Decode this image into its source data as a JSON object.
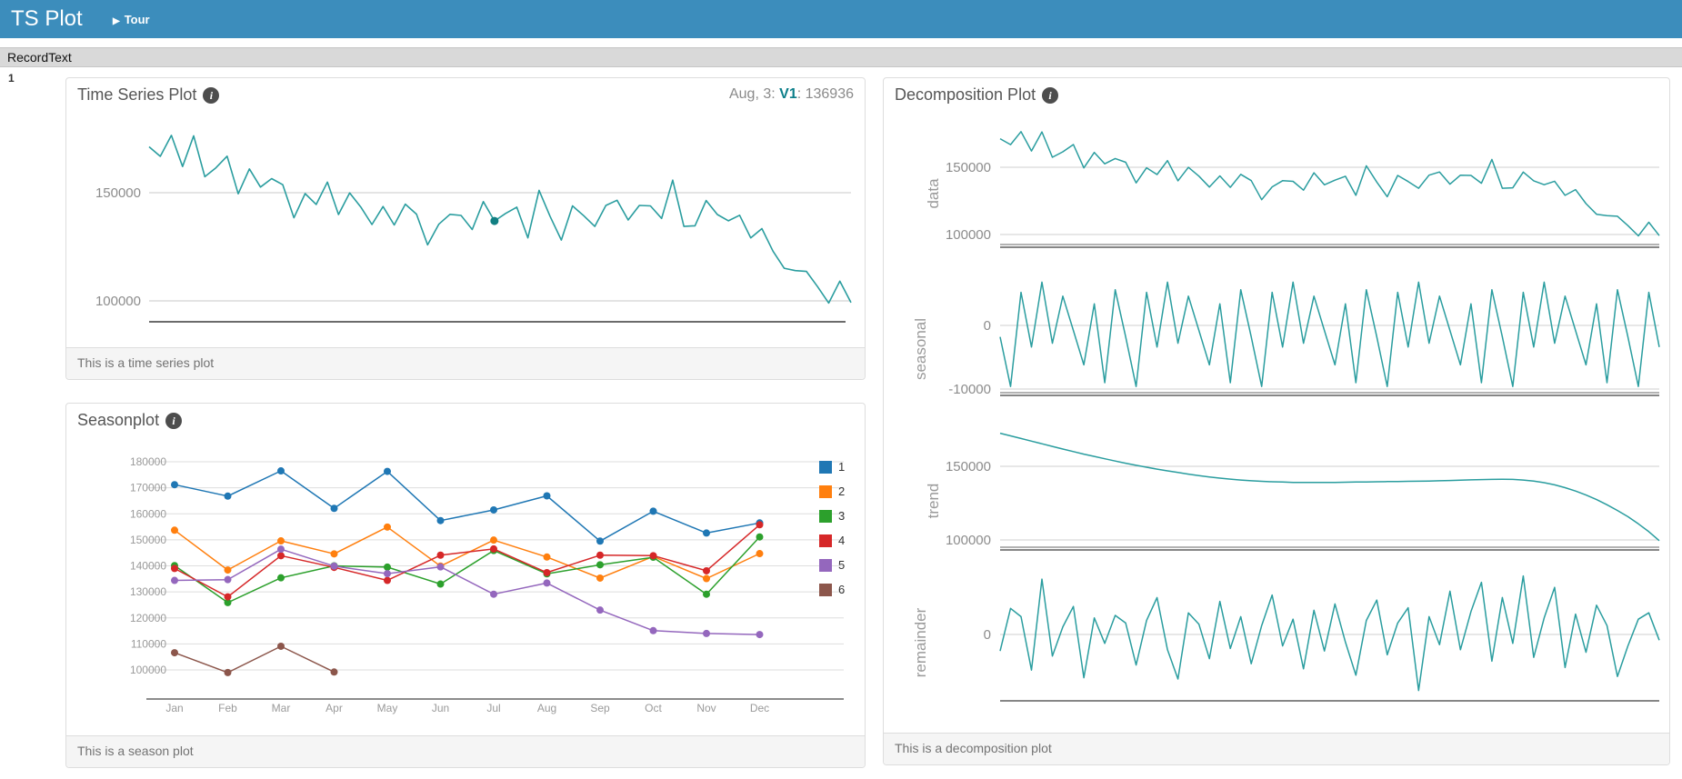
{
  "header": {
    "app_title": "TS Plot",
    "tour_label": "Tour",
    "bg_color": "#3c8dbc"
  },
  "icons": {
    "info": "i",
    "play": "▶"
  },
  "record_bar": {
    "label": "RecordText",
    "row_index": "1"
  },
  "panels": {
    "time_series": {
      "title": "Time Series Plot",
      "hover_prefix": "Aug, 3: ",
      "hover_series": "V1",
      "hover_suffix": ": 136936",
      "footer": "This is a time series plot"
    },
    "seasonplot": {
      "title": "Seasonplot",
      "footer": "This is a season plot"
    },
    "decomposition": {
      "title": "Decomposition Plot",
      "footer": "This is a decomposition plot"
    }
  },
  "colors": {
    "header_bg": "#3c8dbc",
    "line_teal": "#2a9d9f",
    "hover_dot": "#117f82",
    "series_label_teal": "#0c7f8a",
    "grid_light": "#cccccc",
    "axis_dark": "#666666",
    "tick_text": "#8c8c8c"
  },
  "chart_data": [
    {
      "id": "timeseries",
      "type": "line",
      "title": "Time Series Plot",
      "x_unit": "month",
      "x_range": "Year 1 Jan to Year 6 Apr",
      "ylim": [
        75000,
        188000
      ],
      "yticks": [
        150000,
        100000
      ],
      "grid": true,
      "line_color": "#2a9d9f",
      "hover_point": {
        "index": 31,
        "label": "Aug, 3",
        "series": "V1",
        "value": 136936
      },
      "values": [
        171200,
        166800,
        176500,
        162100,
        176300,
        157400,
        161500,
        166900,
        149500,
        161000,
        152600,
        156500,
        153700,
        138400,
        149600,
        144600,
        154900,
        139900,
        149900,
        143400,
        135300,
        143600,
        135100,
        144700,
        140100,
        125900,
        135400,
        140000,
        139500,
        133000,
        145900,
        136936,
        140400,
        143300,
        129100,
        151100,
        139000,
        128100,
        143900,
        139400,
        134400,
        144100,
        146500,
        137400,
        144100,
        143900,
        138100,
        155800,
        134400,
        134700,
        146400,
        139900,
        137000,
        139600,
        129100,
        133400,
        123000,
        115100,
        114000,
        113600,
        106600,
        99000,
        109100,
        99200
      ]
    },
    {
      "id": "seasonplot",
      "type": "line",
      "categories": [
        "Jan",
        "Feb",
        "Mar",
        "Apr",
        "May",
        "Jun",
        "Jul",
        "Aug",
        "Sep",
        "Oct",
        "Nov",
        "Dec"
      ],
      "ylim": [
        95000,
        185000
      ],
      "yticks": [
        180000,
        170000,
        160000,
        150000,
        140000,
        130000,
        120000,
        110000,
        100000
      ],
      "legend_position": "right",
      "series": [
        {
          "name": "1",
          "color": "#1f77b4",
          "values": [
            171200,
            166800,
            176500,
            162100,
            176300,
            157400,
            161500,
            166900,
            149500,
            161000,
            152600,
            156500
          ]
        },
        {
          "name": "2",
          "color": "#ff7f0e",
          "values": [
            153700,
            138400,
            149600,
            144600,
            154900,
            139900,
            149900,
            143400,
            135300,
            143600,
            135100,
            144700
          ]
        },
        {
          "name": "3",
          "color": "#2ca02c",
          "values": [
            140100,
            125900,
            135400,
            140000,
            139500,
            133000,
            145900,
            136936,
            140400,
            143300,
            129100,
            151100
          ]
        },
        {
          "name": "4",
          "color": "#d62728",
          "values": [
            139000,
            128100,
            143900,
            139400,
            134400,
            144100,
            146500,
            137400,
            144100,
            143900,
            138100,
            155800
          ]
        },
        {
          "name": "5",
          "color": "#9467bd",
          "values": [
            134400,
            134700,
            146400,
            139900,
            137000,
            139600,
            129100,
            133400,
            123000,
            115100,
            114000,
            113600
          ]
        },
        {
          "name": "6",
          "color": "#8c564b",
          "values": [
            106600,
            99000,
            109100,
            99200
          ]
        }
      ]
    },
    {
      "id": "decomposition",
      "type": "line",
      "line_color": "#2a9d9f",
      "facets": [
        {
          "name": "data",
          "yticks": [
            150000,
            100000
          ],
          "values": [
            171200,
            166800,
            176500,
            162100,
            176300,
            157400,
            161500,
            166900,
            149500,
            161000,
            152600,
            156500,
            153700,
            138400,
            149600,
            144600,
            154900,
            139900,
            149900,
            143400,
            135300,
            143600,
            135100,
            144700,
            140100,
            125900,
            135400,
            140000,
            139500,
            133000,
            145900,
            136936,
            140400,
            143300,
            129100,
            151100,
            139000,
            128100,
            143900,
            139400,
            134400,
            144100,
            146500,
            137400,
            144100,
            143900,
            138100,
            155800,
            134400,
            134700,
            146400,
            139900,
            137000,
            139600,
            129100,
            133400,
            123000,
            115100,
            114000,
            113600,
            106600,
            99000,
            109100,
            99200
          ]
        },
        {
          "name": "seasonal",
          "yticks": [
            0,
            -10000
          ],
          "values": [
            -1800,
            -9600,
            5200,
            -3400,
            6800,
            -2800,
            4600,
            -800,
            -6200,
            3400,
            -9000,
            5600,
            -1800,
            -9600,
            5200,
            -3400,
            6800,
            -2800,
            4600,
            -800,
            -6200,
            3400,
            -9000,
            5600,
            -1800,
            -9600,
            5200,
            -3400,
            6800,
            -2800,
            4600,
            -800,
            -6200,
            3400,
            -9000,
            5600,
            -1800,
            -9600,
            5200,
            -3400,
            6800,
            -2800,
            4600,
            -800,
            -6200,
            3400,
            -9000,
            5600,
            -1800,
            -9600,
            5200,
            -3400,
            6800,
            -2800,
            4600,
            -800,
            -6200,
            3400,
            -9000,
            5600,
            -1800,
            -9600,
            5200,
            -3400
          ]
        },
        {
          "name": "trend",
          "yticks": [
            150000,
            100000
          ],
          "values": [
            172500,
            170700,
            168900,
            167100,
            165300,
            163500,
            161700,
            160000,
            158300,
            156700,
            155100,
            153600,
            152100,
            150700,
            149400,
            148100,
            146900,
            145800,
            144700,
            143700,
            142800,
            142000,
            141300,
            140700,
            140200,
            139800,
            139500,
            139300,
            139100,
            139000,
            139000,
            139000,
            139100,
            139200,
            139300,
            139400,
            139500,
            139600,
            139700,
            139800,
            139900,
            140000,
            140200,
            140400,
            140600,
            140800,
            141000,
            141100,
            141200,
            141100,
            140700,
            140000,
            138900,
            137400,
            135500,
            133200,
            130500,
            127400,
            123900,
            120000,
            115800,
            110900,
            105600,
            99500
          ]
        },
        {
          "name": "remainder",
          "yticks": [
            0
          ],
          "values": [
            -2600,
            4100,
            2800,
            -5600,
            8700,
            -3400,
            1200,
            4400,
            -6800,
            2600,
            -1400,
            3000,
            1800,
            -4800,
            2200,
            5800,
            -2400,
            -7000,
            3400,
            1600,
            -3800,
            5200,
            -2200,
            2800,
            -4600,
            1400,
            6200,
            -1800,
            2400,
            -5400,
            3800,
            -2600,
            4800,
            -1200,
            -6400,
            2200,
            5400,
            -3200,
            1800,
            4200,
            -8800,
            2800,
            -1600,
            6800,
            -2400,
            3600,
            8200,
            -4200,
            5800,
            -1400,
            9200,
            -3600,
            2600,
            7400,
            -5200,
            3200,
            -2800,
            4600,
            1400,
            -6600,
            -1800,
            2400,
            3400,
            -900
          ]
        }
      ]
    }
  ]
}
